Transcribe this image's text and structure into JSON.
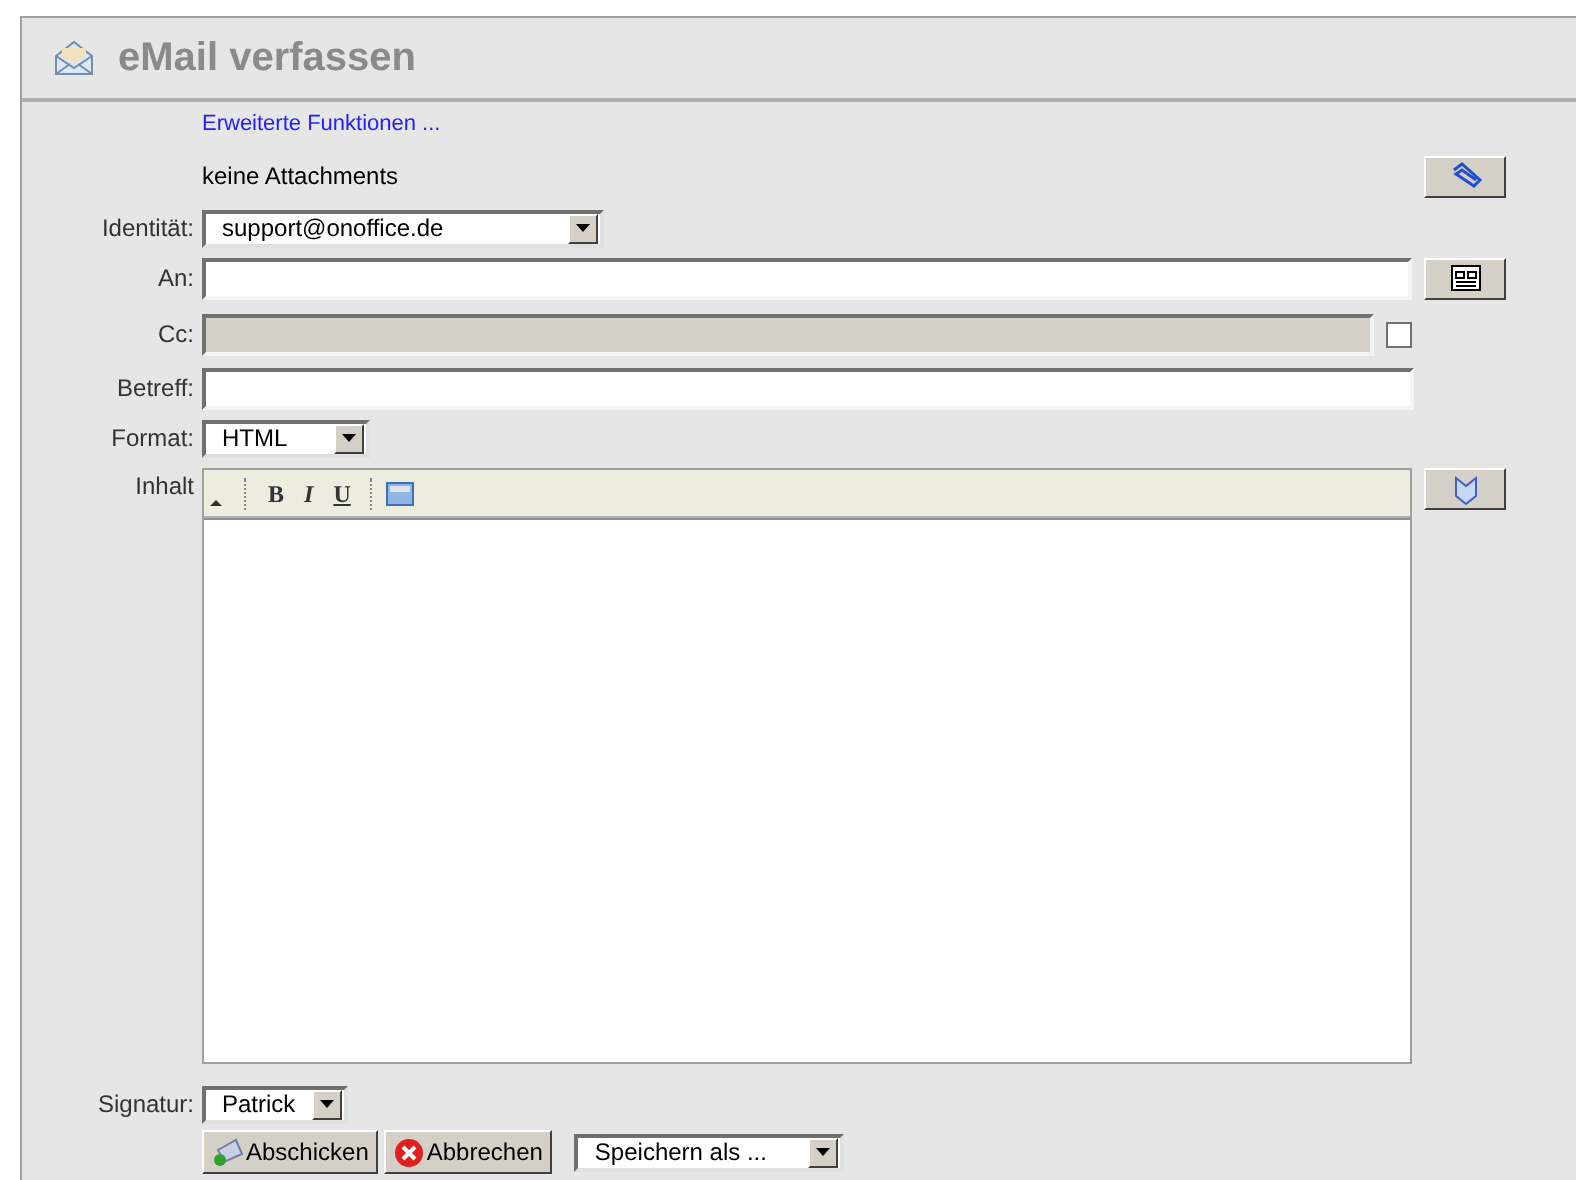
{
  "header": {
    "title": "eMail verfassen"
  },
  "advanced_link": "Erweiterte Funktionen ...",
  "attachments": "keine Attachments",
  "identity": {
    "label": "Identität:",
    "value": "support@onoffice.de"
  },
  "to": {
    "label": "An:"
  },
  "cc": {
    "label": "Cc:",
    "disabled": true,
    "checked": false
  },
  "subject": {
    "label": "Betreff:"
  },
  "format": {
    "label": "Format:",
    "value": "HTML"
  },
  "content": {
    "label": "Inhalt",
    "toolbar": [
      {
        "kind": "bold",
        "label": "B"
      },
      {
        "kind": "italic",
        "label": "I"
      },
      {
        "kind": "underline",
        "label": "U"
      },
      {
        "kind": "image"
      }
    ]
  },
  "signature": {
    "label": "Signatur:",
    "value": "Patrick"
  },
  "buttons": [
    {
      "kind": "send",
      "label": "Abschicken"
    },
    {
      "kind": "cancel",
      "label": "Abbrechen"
    }
  ],
  "save_as": {
    "value": "Speichern als ..."
  }
}
